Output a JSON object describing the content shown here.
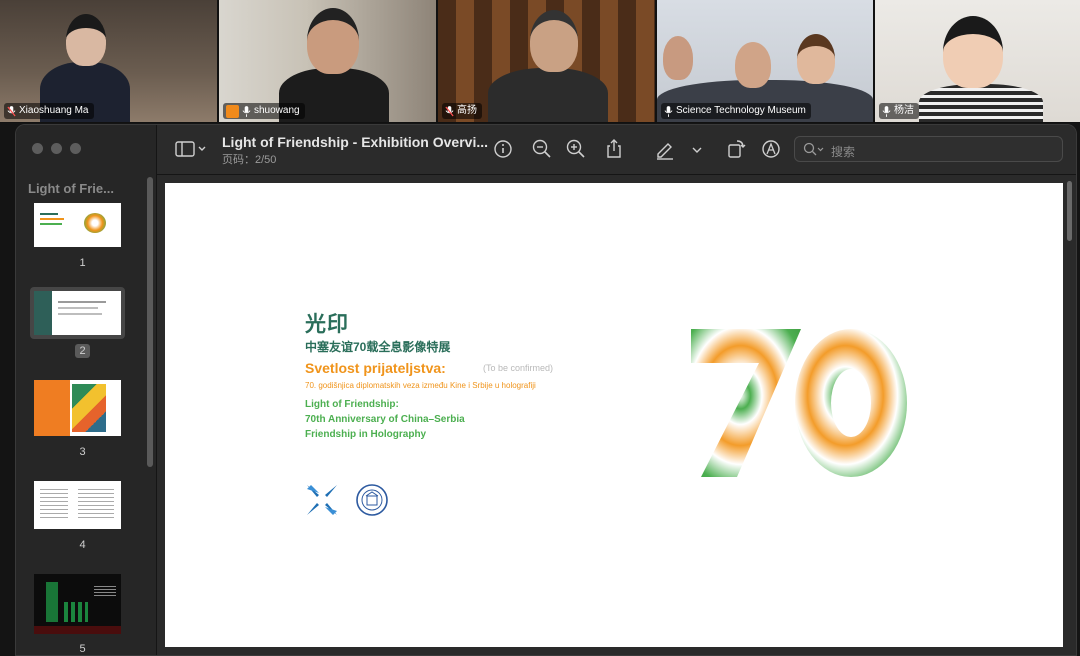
{
  "participants": [
    {
      "name": "Xiaoshuang Ma",
      "mic": "muted"
    },
    {
      "name": "shuowang",
      "mic": "on",
      "speaking": true
    },
    {
      "name": "高扬",
      "mic": "muted"
    },
    {
      "name": "Science Technology Museum",
      "mic": "on"
    },
    {
      "name": "杨洁",
      "mic": "on"
    }
  ],
  "window": {
    "sidebar_title": "Light of Frie...",
    "doc_title": "Light of Friendship - Exhibition Overvi...",
    "page_indicator": "页码：2/50",
    "search_placeholder": "搜索"
  },
  "thumbnails": [
    {
      "num": "1"
    },
    {
      "num": "2",
      "selected": true
    },
    {
      "num": "3"
    },
    {
      "num": "4"
    },
    {
      "num": "5"
    }
  ],
  "slide": {
    "title_cn": "光印",
    "subtitle_cn": "中塞友谊70载全息影像特展",
    "title_sr": "Svetlost prijateljstva:",
    "tbc": "(To be confirmed)",
    "subtitle_sr": "70. godišnjica diplomatskih veza između Kine i Srbije u holografiji",
    "en_lines": [
      "Light of Friendship:",
      "70th Anniversary of China–Serbia",
      "Friendship in Holography"
    ],
    "big_number": "70"
  },
  "colors": {
    "accent_green": "#2bd07c",
    "slide_green": "#2a6e5a",
    "slide_orange": "#f0941b",
    "slide_light_green": "#4caf50"
  }
}
